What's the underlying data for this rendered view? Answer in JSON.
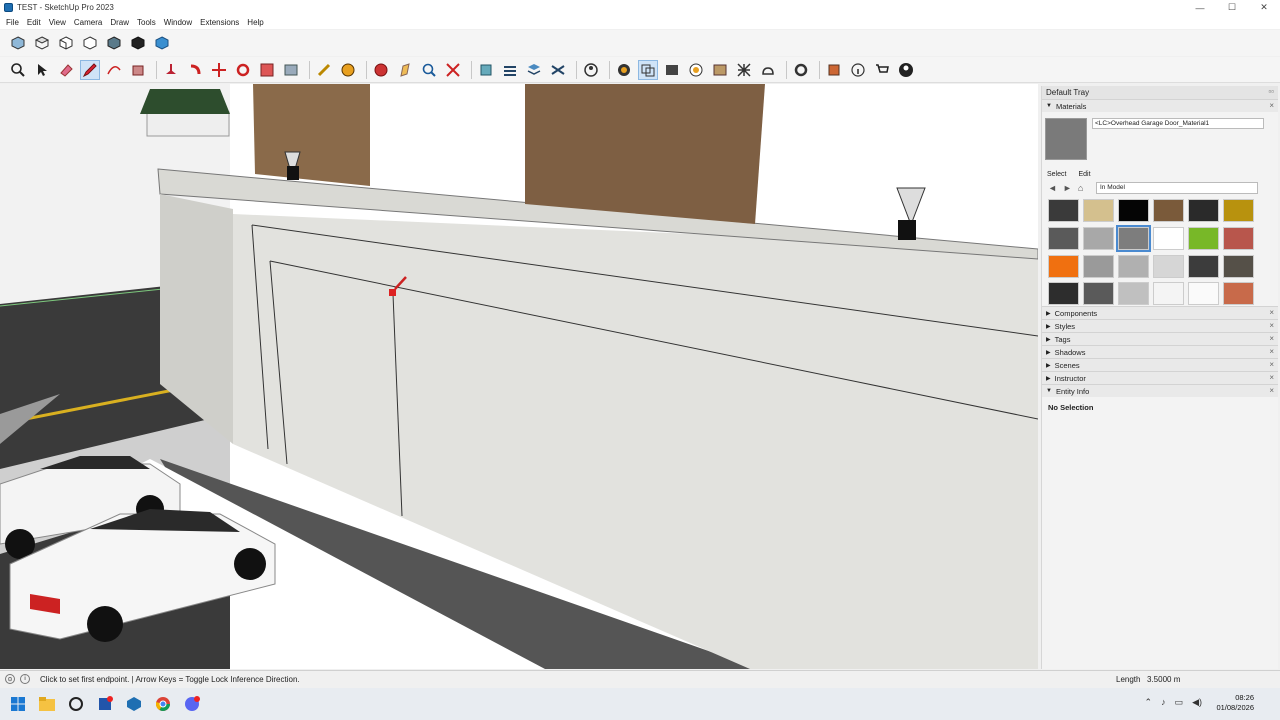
{
  "app": {
    "title": "TEST - SketchUp Pro 2023"
  },
  "window_controls": {
    "minimize": "—",
    "maximize": "☐",
    "close": "✕"
  },
  "menu": [
    "File",
    "Edit",
    "View",
    "Camera",
    "Draw",
    "Tools",
    "Window",
    "Extensions",
    "Help"
  ],
  "tray": {
    "title": "Default Tray",
    "materials": {
      "header": "Materials",
      "current_name": "<LC>Overhead Garage Door_Material1",
      "tab_select": "Select",
      "tab_edit": "Edit",
      "collection": "In Model",
      "swatch_colors": [
        "#3a3a3a",
        "#d4c08e",
        "#050505",
        "#7a5a3a",
        "#2a2a2a",
        "#b8920e",
        "#5a5a5a",
        "#a8a8a8",
        "#7d7d7d",
        "#ffffff",
        "#78b828",
        "#b8564c",
        "#f07010",
        "#9a9a9a",
        "#b0b0b0",
        "#d6d6d6",
        "#3c3c3c",
        "#555048",
        "#2d2d2d",
        "#5a5a5a",
        "#c0c0c0",
        "#f4f4f4",
        "#fafafa",
        "#c86a4a"
      ],
      "selected_index": 8
    },
    "panels": [
      "Components",
      "Styles",
      "Tags",
      "Shadows",
      "Scenes",
      "Instructor"
    ],
    "entity_info": {
      "header": "Entity Info",
      "selection": "No Selection"
    }
  },
  "status": {
    "hint": "Click to set first endpoint. | Arrow Keys = Toggle Lock Inference Direction.",
    "length_label": "Length",
    "length_value": "3.5000 m"
  },
  "clock": {
    "time": "08:26",
    "date": "01/08/2026"
  },
  "toolbar_icons": {
    "row1": [
      "iso-view-icon",
      "top-view-icon",
      "front-view-icon",
      "right-view-icon",
      "back-view-icon",
      "left-view-icon",
      "bottom-view-icon"
    ],
    "row2": [
      "zoom-icon",
      "select-icon",
      "eraser-icon",
      "pencil-icon",
      "arc-icon",
      "rectangle-icon",
      "push-pull-icon",
      "follow-me-icon",
      "move-icon",
      "rotate-icon",
      "scale-icon",
      "offset-icon",
      "tape-measure-icon",
      "paint-bucket-icon",
      "orbit-icon",
      "pan-icon",
      "zoom-tool-icon",
      "zoom-extents-icon",
      "section-plane-icon",
      "section-fill-icon",
      "display-section-icon",
      "outliner-icon",
      "styles-icon",
      "components-icon",
      "tags-icon",
      "scenes-icon",
      "materials-icon",
      "shadows-icon",
      "fog-icon",
      "extension-manager-icon",
      "solid-tools-icon",
      "entity-info-icon",
      "warehouse-icon",
      "account-icon"
    ]
  }
}
